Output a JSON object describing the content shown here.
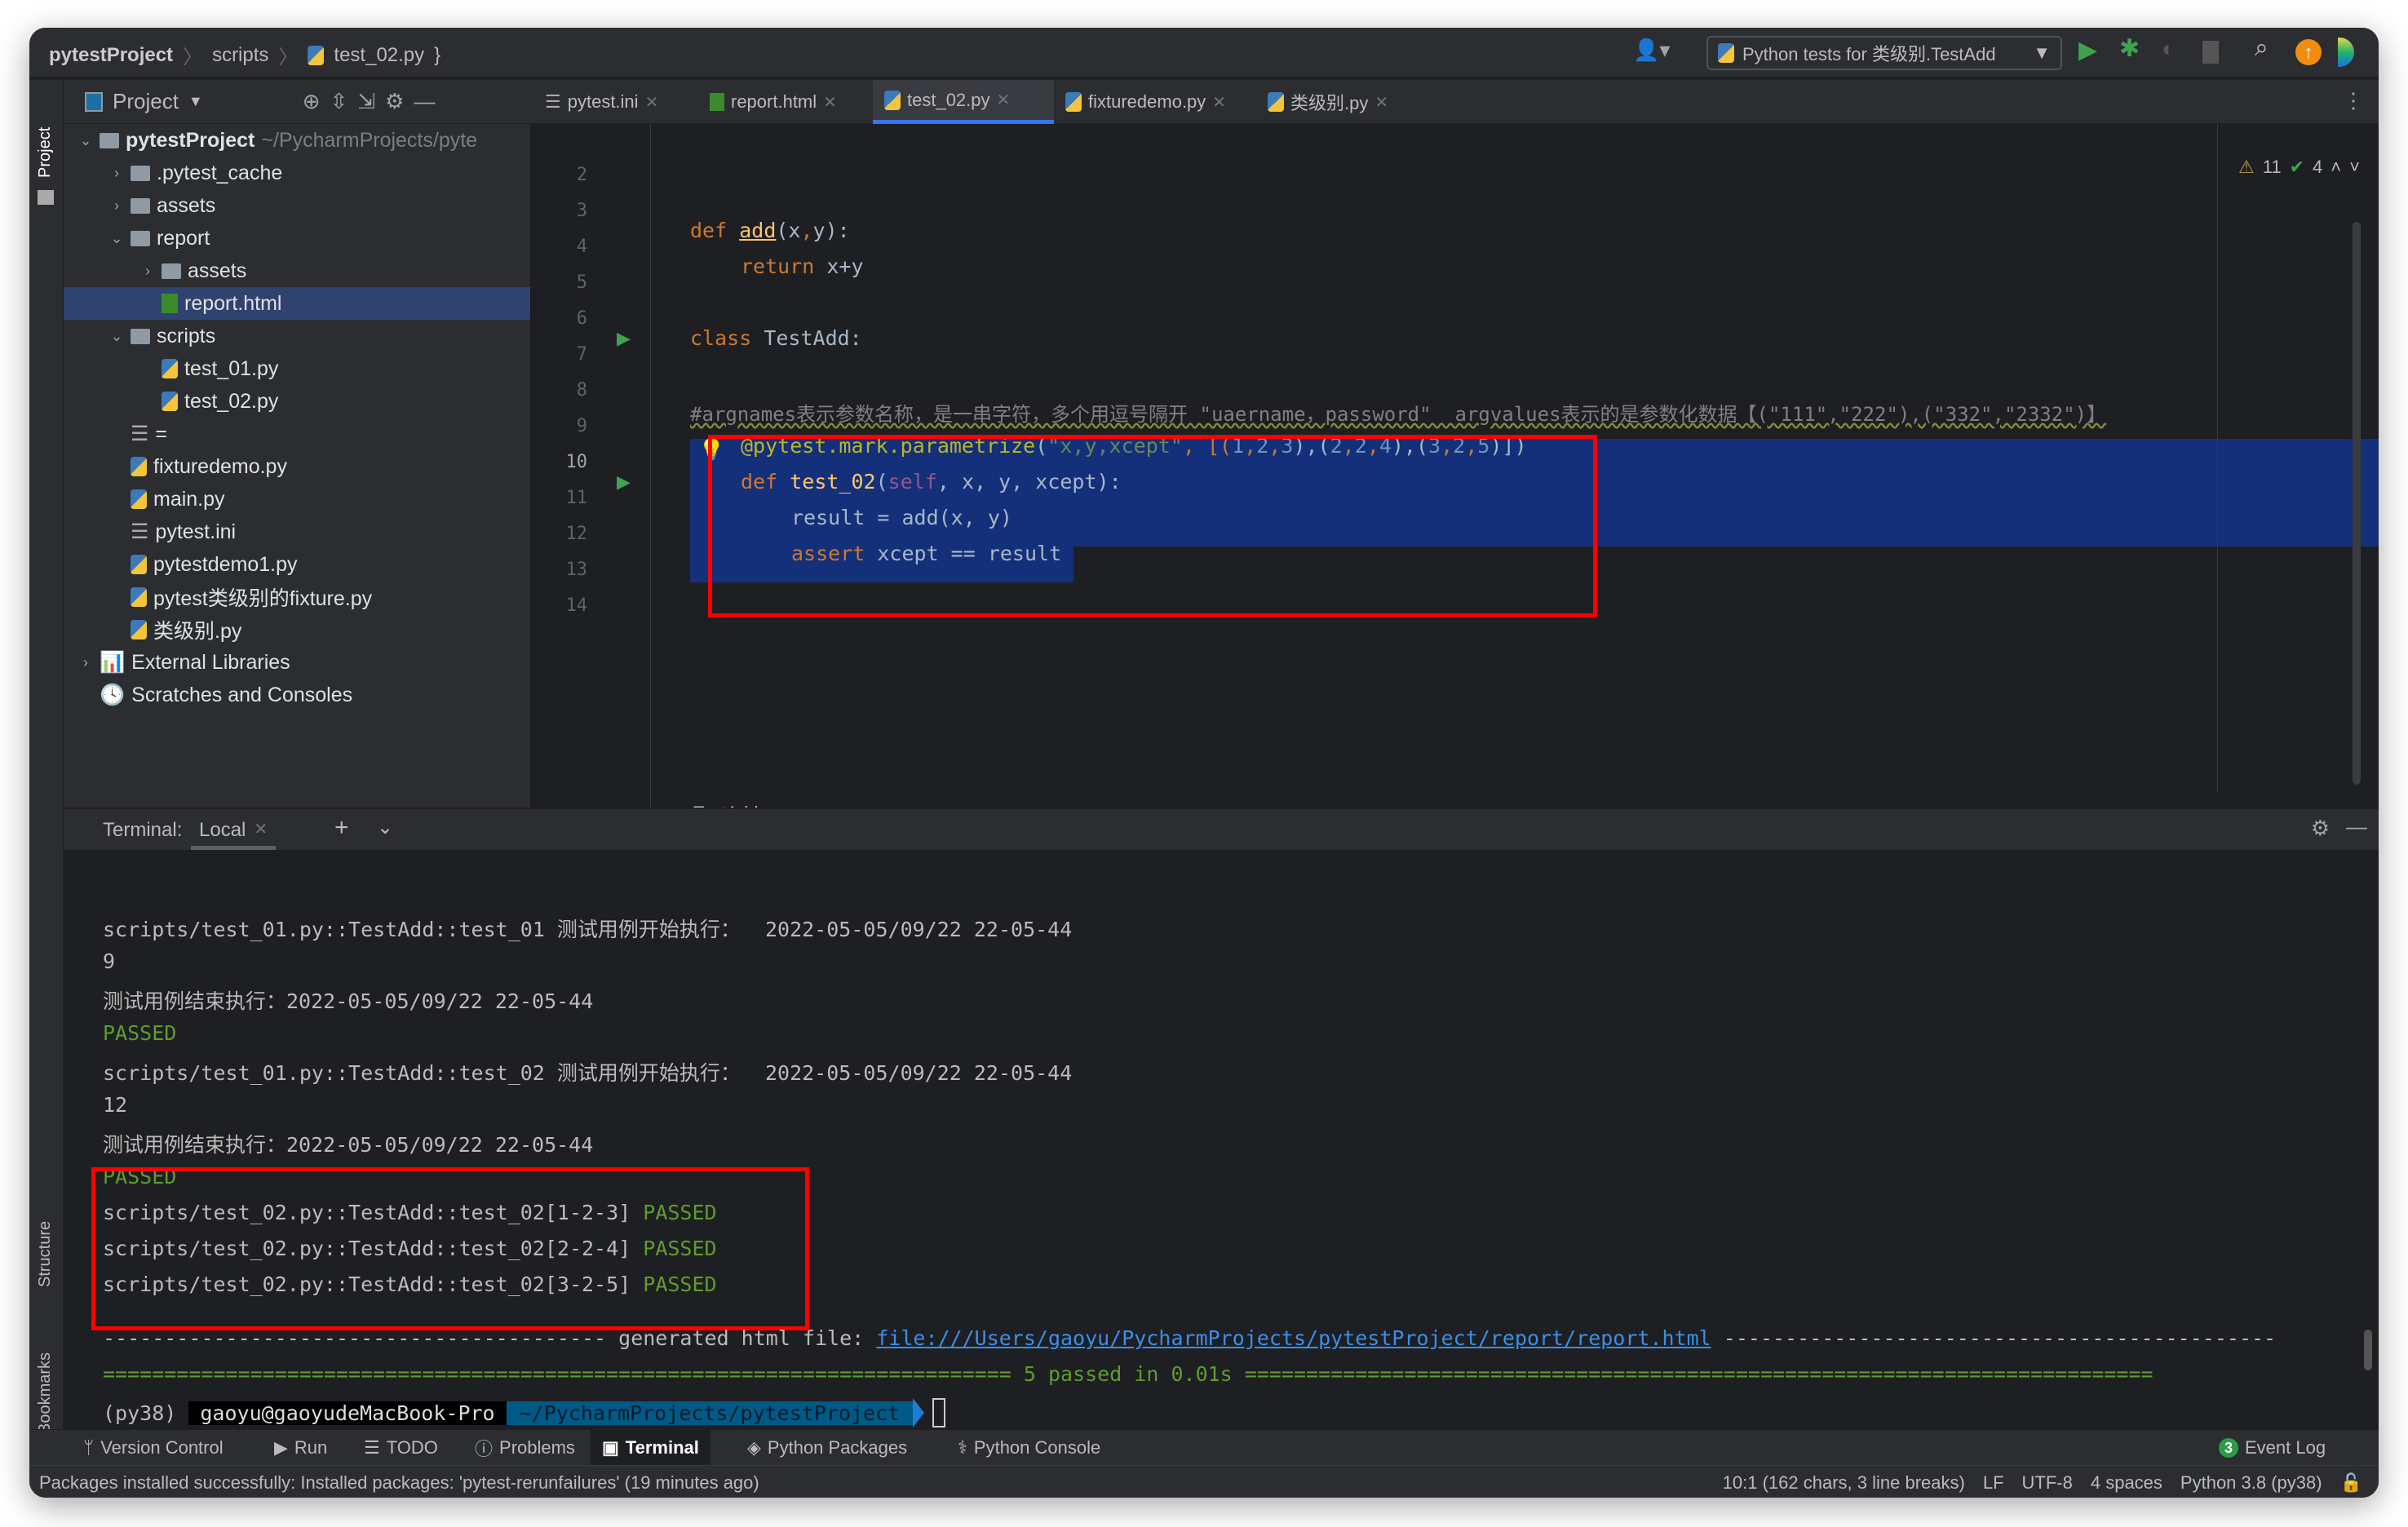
{
  "navbar": {
    "breadcrumb": [
      "pytestProject",
      "scripts",
      "test_02.py"
    ],
    "run_config": "Python tests for 类级别.TestAdd"
  },
  "colors": {
    "accent": "#3574f0",
    "selection": "#14307a",
    "highlight_box": "#ff0000",
    "passed": "#5f9c2f",
    "link": "#3b8eea"
  },
  "project": {
    "title": "Project",
    "tree": [
      {
        "label": "pytestProject",
        "suffix": "~/PycharmProjects/pyte",
        "depth": 0,
        "type": "folder",
        "expanded": true
      },
      {
        "label": ".pytest_cache",
        "depth": 1,
        "type": "folder",
        "expanded": false
      },
      {
        "label": "assets",
        "depth": 1,
        "type": "folder",
        "expanded": false
      },
      {
        "label": "report",
        "depth": 1,
        "type": "folder",
        "expanded": true
      },
      {
        "label": "assets",
        "depth": 2,
        "type": "folder",
        "expanded": false
      },
      {
        "label": "report.html",
        "depth": 2,
        "type": "html",
        "selected": true
      },
      {
        "label": "scripts",
        "depth": 1,
        "type": "folder",
        "expanded": true
      },
      {
        "label": "test_01.py",
        "depth": 2,
        "type": "py"
      },
      {
        "label": "test_02.py",
        "depth": 2,
        "type": "py"
      },
      {
        "label": "=",
        "depth": 1,
        "type": "file"
      },
      {
        "label": "fixturedemo.py",
        "depth": 1,
        "type": "py"
      },
      {
        "label": "main.py",
        "depth": 1,
        "type": "py"
      },
      {
        "label": "pytest.ini",
        "depth": 1,
        "type": "ini"
      },
      {
        "label": "pytestdemo1.py",
        "depth": 1,
        "type": "py"
      },
      {
        "label": "pytest类级别的fixture.py",
        "depth": 1,
        "type": "py"
      },
      {
        "label": "类级别.py",
        "depth": 1,
        "type": "py"
      },
      {
        "label": "External Libraries",
        "depth": 0,
        "type": "lib",
        "expanded": false
      },
      {
        "label": "Scratches and Consoles",
        "depth": 0,
        "type": "scratch"
      }
    ]
  },
  "tabs": [
    {
      "label": "pytest.ini"
    },
    {
      "label": "report.html"
    },
    {
      "label": "test_02.py",
      "active": true
    },
    {
      "label": "fixturedemo.py"
    },
    {
      "label": "类级别.py"
    }
  ],
  "editor": {
    "inspections": {
      "warnings": "11",
      "typos": "4"
    },
    "line_numbers": [
      "2",
      "3",
      "4",
      "5",
      "6",
      "7",
      "8",
      "9",
      "10",
      "11",
      "12",
      "13",
      "14"
    ],
    "breadcrumb": "TestAdd",
    "code": {
      "l4": [
        "def ",
        "add",
        "(x",
        ",",
        "y):"
      ],
      "l5": [
        "return ",
        "x+y"
      ],
      "l7": [
        "class ",
        "TestAdd:"
      ],
      "l9": "#argnames表示参数名称，是一串字符，多个用逗号隔开 \"uaername，password\"  argvalues表示的是参数化数据【(\"111\",\"222\"),(\"332\",\"2332\")】",
      "l10": [
        "@pytest.mark.parametrize",
        "(",
        "\"x,y,xcept\"",
        ", [(",
        "1",
        ",",
        "2",
        ",",
        "3",
        "),(",
        "2",
        ",",
        "2",
        ",",
        "4",
        "),(",
        "3",
        ",",
        "2",
        ",",
        "5",
        ")])"
      ],
      "l11": [
        "def ",
        "test_02",
        "(",
        "self",
        ", x, y, xcept):"
      ],
      "l12": "result = add(x, y)",
      "l13": [
        "assert ",
        "xcept == result"
      ]
    }
  },
  "terminal": {
    "label": "Terminal:",
    "tab": "Local",
    "lines": [
      "scripts/test_01.py::TestAdd::test_01 测试用例开始执行：  2022-05-05/09/22 22-05-44",
      "9",
      "测试用例结束执行：2022-05-05/09/22 22-05-44",
      "PASSED",
      "scripts/test_01.py::TestAdd::test_02 测试用例开始执行：  2022-05-05/09/22 22-05-44",
      "12",
      "测试用例结束执行：2022-05-05/09/22 22-05-44",
      "PASSED"
    ],
    "param_results": [
      {
        "id": "scripts/test_02.py::TestAdd::test_02[1-2-3] ",
        "status": "PASSED"
      },
      {
        "id": "scripts/test_02.py::TestAdd::test_02[2-2-4] ",
        "status": "PASSED"
      },
      {
        "id": "scripts/test_02.py::TestAdd::test_02[3-2-5] ",
        "status": "PASSED"
      }
    ],
    "report_prefix": "----------------------------------------- generated html file: ",
    "report_link": "file:///Users/gaoyu/PycharmProjects/pytestProject/report/report.html",
    "report_suffix": " ---------------------------------------------",
    "summary_left": "========================================================================== ",
    "summary": "5 passed in 0.01s",
    "summary_right": " ==========================================================================",
    "prompt": {
      "env": "(py38)",
      "host": "gaoyu@gaoyudeMacBook-Pro",
      "path": "~/PycharmProjects/pytestProject"
    }
  },
  "toolwindows": [
    "Version Control",
    "Run",
    "TODO",
    "Problems",
    "Terminal",
    "Python Packages",
    "Python Console"
  ],
  "event_log": {
    "count": "3",
    "label": "Event Log"
  },
  "side_labels": {
    "project": "Project",
    "structure": "Structure",
    "bookmarks": "Bookmarks"
  },
  "status": {
    "message": "Packages installed successfully: Installed packages: 'pytest-rerunfailures' (19 minutes ago)",
    "position": "10:1 (162 chars, 3 line breaks)",
    "line_sep": "LF",
    "encoding": "UTF-8",
    "indent": "4 spaces",
    "interpreter": "Python 3.8 (py38)"
  }
}
